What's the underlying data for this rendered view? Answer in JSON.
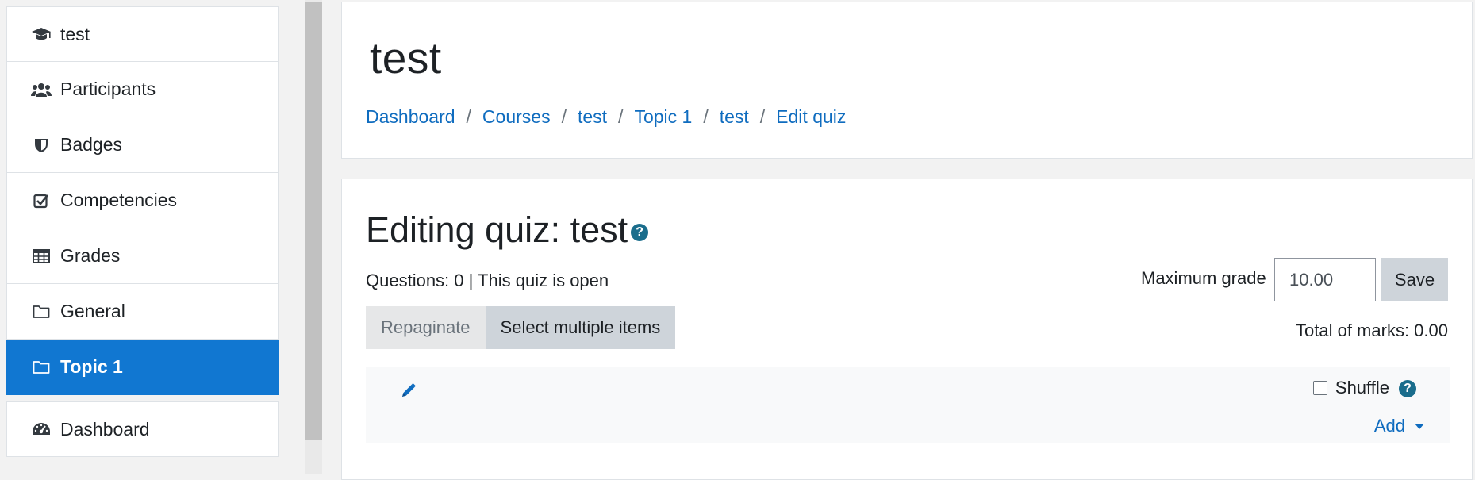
{
  "sidebar": {
    "items": [
      {
        "label": "test",
        "icon": "graduation-cap-icon"
      },
      {
        "label": "Participants",
        "icon": "users-icon"
      },
      {
        "label": "Badges",
        "icon": "shield-icon"
      },
      {
        "label": "Competencies",
        "icon": "check-square-icon"
      },
      {
        "label": "Grades",
        "icon": "table-icon"
      },
      {
        "label": "General",
        "icon": "folder-icon"
      },
      {
        "label": "Topic 1",
        "icon": "folder-icon",
        "active": true
      },
      {
        "label": "Dashboard",
        "icon": "dashboard-icon"
      }
    ]
  },
  "header": {
    "title": "test",
    "breadcrumb": [
      "Dashboard",
      "Courses",
      "test",
      "Topic 1",
      "test",
      "Edit quiz"
    ],
    "separator": "/"
  },
  "main": {
    "heading": "Editing quiz: test",
    "help_glyph": "?",
    "info": "Questions: 0 | This quiz is open",
    "repaginate_label": "Repaginate",
    "select_multiple_label": "Select multiple items",
    "max_grade_label": "Maximum grade",
    "max_grade_value": "10.00",
    "save_label": "Save",
    "total_marks": "Total of marks: 0.00",
    "section": {
      "shuffle_label": "Shuffle",
      "shuffle_checked": false,
      "add_label": "Add"
    }
  },
  "colors": {
    "accent": "#1177d1",
    "link": "#0f6cbf",
    "help": "#1a6d8c"
  }
}
